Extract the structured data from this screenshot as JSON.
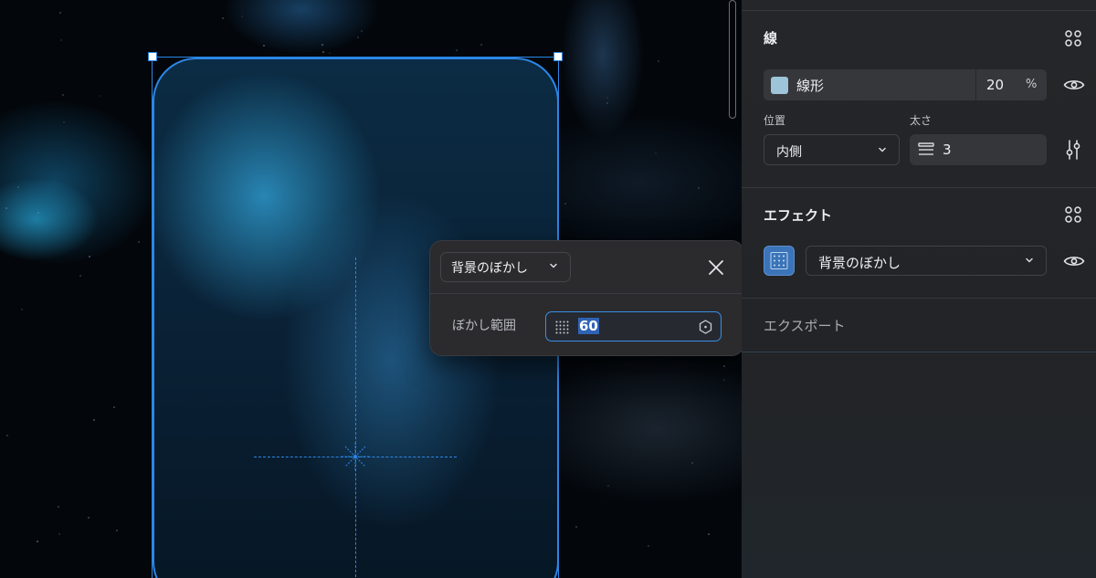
{
  "popover": {
    "effect_type": "背景のぼかし",
    "blur_label": "ぼかし範囲",
    "blur_value": "60"
  },
  "panel": {
    "stroke": {
      "title": "線",
      "fill_type": "線形",
      "opacity": "20",
      "opacity_unit": "%",
      "swatch_color": "#9dc4d8",
      "position_label": "位置",
      "position_value": "内側",
      "width_label": "太さ",
      "width_value": "3"
    },
    "effect": {
      "title": "エフェクト",
      "type": "背景のぼかし"
    },
    "export": {
      "title": "エクスポート"
    }
  },
  "colors": {
    "selection": "#2d86e6",
    "panel_bg": "#252629",
    "popover_bg": "#2b2b2e"
  },
  "icons": [
    "chevron-down-icon",
    "close-icon",
    "grid-dots-icon",
    "hexagon-icon",
    "four-dots-icon",
    "eye-icon",
    "stroke-width-icon",
    "sliders-icon"
  ]
}
